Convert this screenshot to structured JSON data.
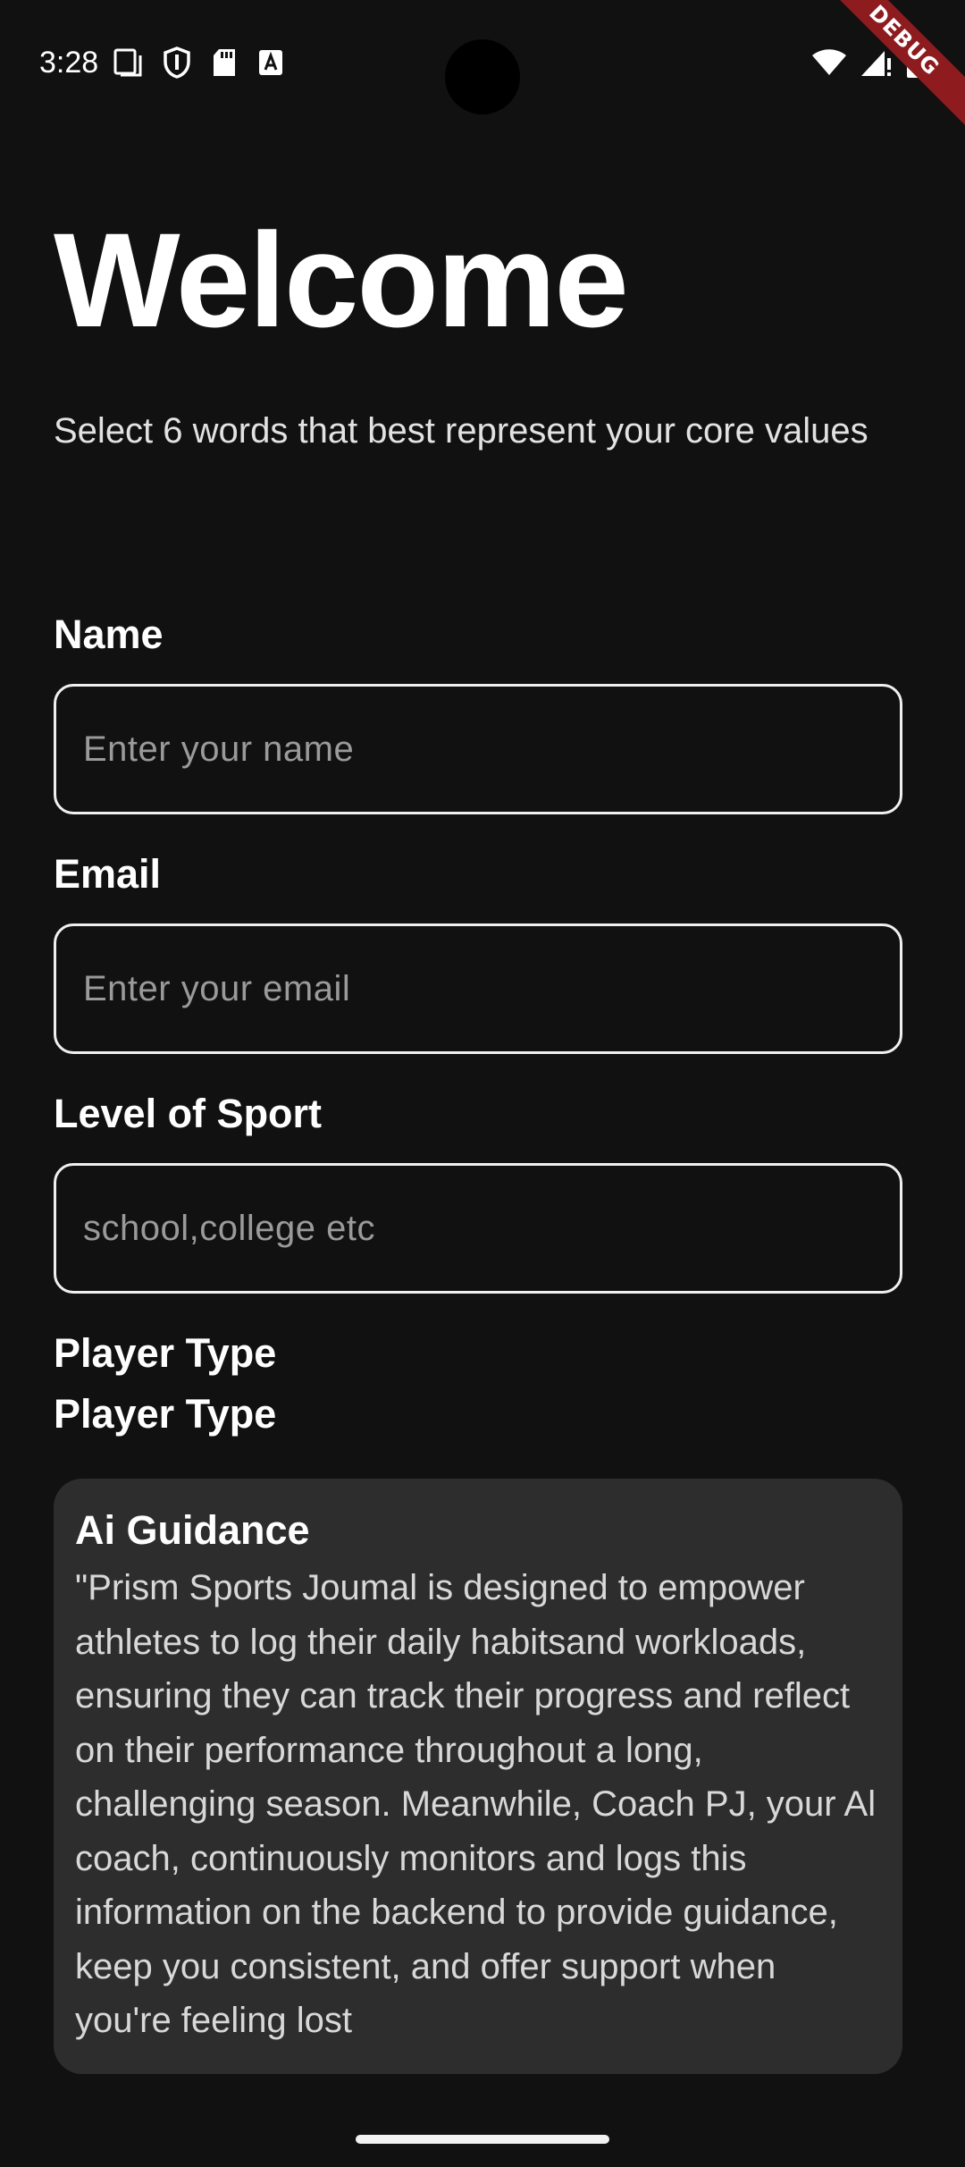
{
  "status_bar": {
    "time": "3:28",
    "left_icons": [
      "screen-icon",
      "shield-icon",
      "sd-card-icon",
      "font-a-icon"
    ],
    "right_icons": [
      "wifi-icon",
      "signal-icon",
      "battery-icon"
    ],
    "debug_label": "DEBUG"
  },
  "page": {
    "title": "Welcome",
    "subtitle": "Select 6 words that best represent your core values"
  },
  "form": {
    "name": {
      "label": "Name",
      "value": "",
      "placeholder": "Enter your name"
    },
    "email": {
      "label": "Email",
      "value": "",
      "placeholder": "Enter your email"
    },
    "level": {
      "label": "Level of Sport",
      "value": "",
      "placeholder": "school,college etc"
    },
    "player_type": {
      "label": "Player Type",
      "label_repeat": "Player Type"
    }
  },
  "guidance": {
    "title": "Ai Guidance",
    "body": "\"Prism Sports Joumal is designed to empower athletes to log their daily habitsand workloads, ensuring they can track their progress and reflect on their performance throughout a long, challenging season. Meanwhile, Coach PJ, your Al coach, continuously monitors and logs this information on the backend to provide guidance, keep you consistent, and offer support when you're feeling lost"
  },
  "colors": {
    "background": "#111112",
    "card": "#2d2d2e",
    "debug_ribbon": "#8e1b1e",
    "text": "#ffffff",
    "placeholder": "#9a9a9a"
  }
}
